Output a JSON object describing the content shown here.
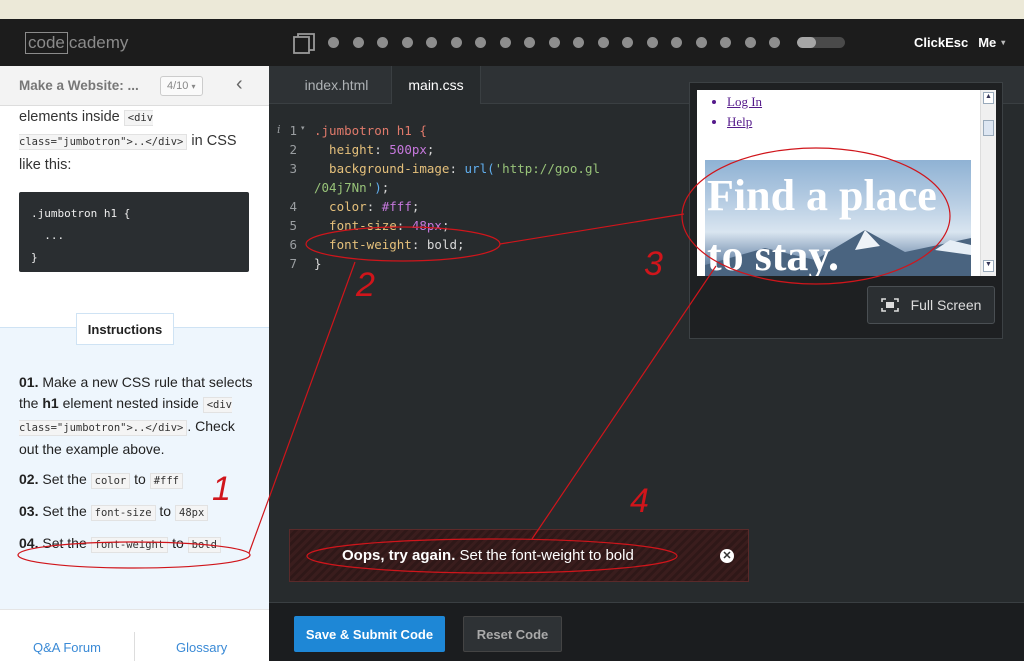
{
  "topbar": {
    "logo_box": "code",
    "logo_rest": "cademy",
    "progress_fraction": 0.4,
    "user_name": "ClickEsc",
    "user_menu": "Me"
  },
  "sidebar": {
    "title": "Make a Website: ...",
    "counter": "4/10",
    "lesson": {
      "pre": "elements inside",
      "code1": "<div class=\"jumbotron\">..</div>",
      "post": "in CSS like this:"
    },
    "example_code": ".jumbotron h1 {\n  ...\n}",
    "instructions_tab": "Instructions",
    "steps": [
      {
        "num": "01.",
        "text1": "Make a new CSS rule that selects the",
        "bold": "h1",
        "text2": "element nested inside",
        "code": "<div class=\"jumbotron\">..</div>",
        "text3": ". Check out the example above."
      },
      {
        "num": "02.",
        "text1": "Set the",
        "code1": "color",
        "mid": "to",
        "code2": "#fff"
      },
      {
        "num": "03.",
        "text1": "Set the",
        "code1": "font-size",
        "mid": "to",
        "code2": "48px"
      },
      {
        "num": "04.",
        "text1": "Set the",
        "code1": "font-weight",
        "mid": "to",
        "code2": "bold"
      }
    ],
    "footer_links": [
      "Q&A Forum",
      "Glossary"
    ]
  },
  "editor": {
    "tabs": [
      "index.html",
      "main.css"
    ],
    "active_tab": "main.css",
    "gutter_info": "i",
    "lines": [
      {
        "num": "1",
        "parts": [
          {
            "t": ".jumbotron h1 {",
            "c": "sel"
          }
        ]
      },
      {
        "num": "2",
        "parts": [
          {
            "t": "  height",
            "c": "prop"
          },
          {
            "t": ": ",
            "c": ""
          },
          {
            "t": "500px",
            "c": "num"
          },
          {
            "t": ";",
            "c": ""
          }
        ]
      },
      {
        "num": "3",
        "parts": [
          {
            "t": "  background-image",
            "c": "prop"
          },
          {
            "t": ": ",
            "c": ""
          },
          {
            "t": "url(",
            "c": "fn"
          },
          {
            "t": "'http://goo.gl",
            "c": "str"
          }
        ]
      },
      {
        "num": "",
        "parts": [
          {
            "t": "/04j7Nn'",
            "c": "str"
          },
          {
            "t": ")",
            "c": "fn"
          },
          {
            "t": ";",
            "c": ""
          }
        ]
      },
      {
        "num": "4",
        "parts": [
          {
            "t": "  color",
            "c": "prop"
          },
          {
            "t": ": ",
            "c": ""
          },
          {
            "t": "#fff",
            "c": "num"
          },
          {
            "t": ";",
            "c": ""
          }
        ]
      },
      {
        "num": "5",
        "parts": [
          {
            "t": "  font-size",
            "c": "prop"
          },
          {
            "t": ": ",
            "c": ""
          },
          {
            "t": "48px",
            "c": "num"
          },
          {
            "t": ";",
            "c": ""
          }
        ]
      },
      {
        "num": "6",
        "parts": [
          {
            "t": "  font-weight",
            "c": "prop"
          },
          {
            "t": ": ",
            "c": ""
          },
          {
            "t": "bold",
            "c": ""
          },
          {
            "t": ";",
            "c": ""
          }
        ]
      },
      {
        "num": "7",
        "parts": [
          {
            "t": "}",
            "c": ""
          }
        ]
      }
    ]
  },
  "preview": {
    "links": [
      "Log In",
      "Help"
    ],
    "heading": "Find a place to stay.",
    "fullscreen_label": "Full Screen"
  },
  "error": {
    "bold": "Oops, try again.",
    "text": " Set the font-weight to bold",
    "close_glyph": "✕"
  },
  "buttons": {
    "save": "Save & Submit Code",
    "reset": "Reset Code"
  },
  "annotations": {
    "labels": [
      "1",
      "2",
      "3",
      "4"
    ],
    "color": "#d0151b"
  }
}
